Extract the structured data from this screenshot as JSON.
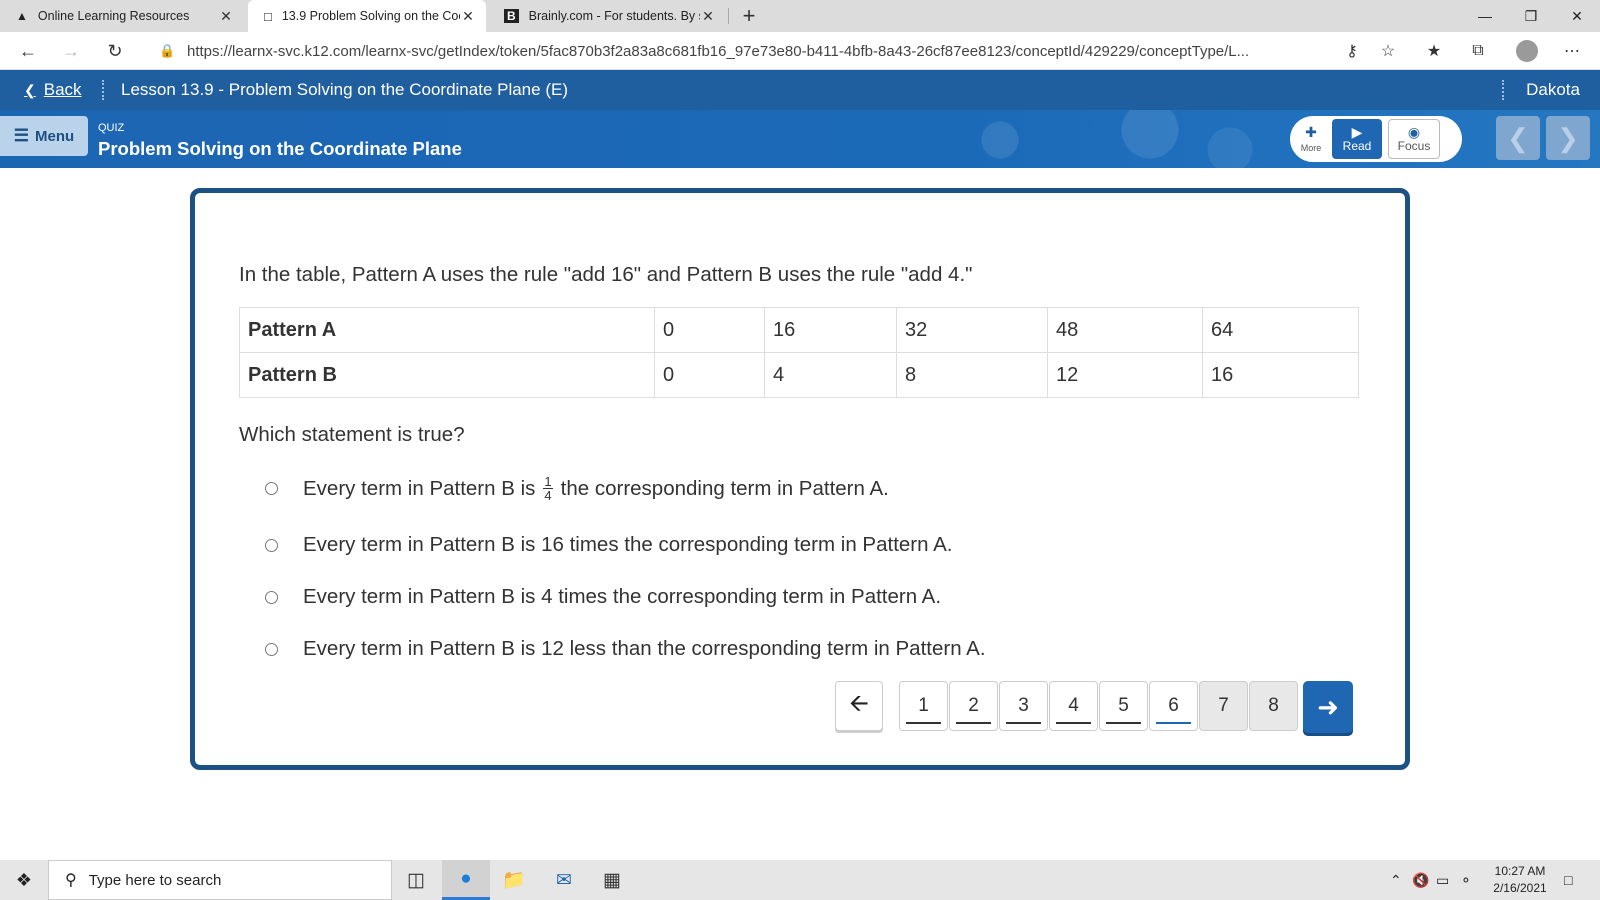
{
  "browser": {
    "tabs": [
      {
        "title": "Online Learning Resources",
        "icon": "tree-icon",
        "active": false
      },
      {
        "title": "13.9 Problem Solving on the Coo",
        "icon": "document-icon",
        "active": true
      },
      {
        "title": "Brainly.com - For students. By stu",
        "icon": "brainly-icon",
        "active": false
      }
    ],
    "url": "https://learnx-svc.k12.com/learnx-svc/getIndex/token/5fac870b3f2a83a8c681fb16_97e73e80-b411-4bfb-8a43-26cf87ee8123/conceptId/429229/conceptType/L..."
  },
  "lessonbar": {
    "back_label": "Back",
    "lesson_title": "Lesson 13.9 - Problem Solving on the Coordinate Plane (E)",
    "user_name": "Dakota"
  },
  "quizheader": {
    "menu_label": "Menu",
    "type_label": "QUIZ",
    "title": "Problem Solving on the Coordinate Plane",
    "tools": {
      "more": "More",
      "read": "Read",
      "focus": "Focus"
    }
  },
  "question": {
    "text": "In the table, Pattern A uses the rule \"add 16\" and Pattern B uses the rule \"add 4.\"",
    "table": [
      {
        "label": "Pattern A",
        "values": [
          "0",
          "16",
          "32",
          "48",
          "64"
        ]
      },
      {
        "label": "Pattern B",
        "values": [
          "0",
          "4",
          "8",
          "12",
          "16"
        ]
      }
    ],
    "prompt": "Which statement is true?",
    "options": [
      {
        "pre": "Every term in Pattern B is",
        "num": "1",
        "den": "4",
        "post": "the corresponding term in Pattern A."
      },
      {
        "text": "Every term in Pattern B is 16 times the corresponding term in Pattern A."
      },
      {
        "text": "Every term in Pattern B is 4 times the corresponding term in Pattern A."
      },
      {
        "text": "Every term in Pattern B is 12 less than the corresponding term in Pattern A."
      }
    ]
  },
  "pagination": {
    "pages": [
      "1",
      "2",
      "3",
      "4",
      "5",
      "6",
      "7",
      "8"
    ],
    "current": "6"
  },
  "taskbar": {
    "search_placeholder": "Type here to search",
    "time": "10:27 AM",
    "date": "2/16/2021"
  },
  "colors": {
    "brand_blue": "#1f5e9f",
    "card_border": "#1c5184",
    "accent_blue": "#1f66b3"
  }
}
